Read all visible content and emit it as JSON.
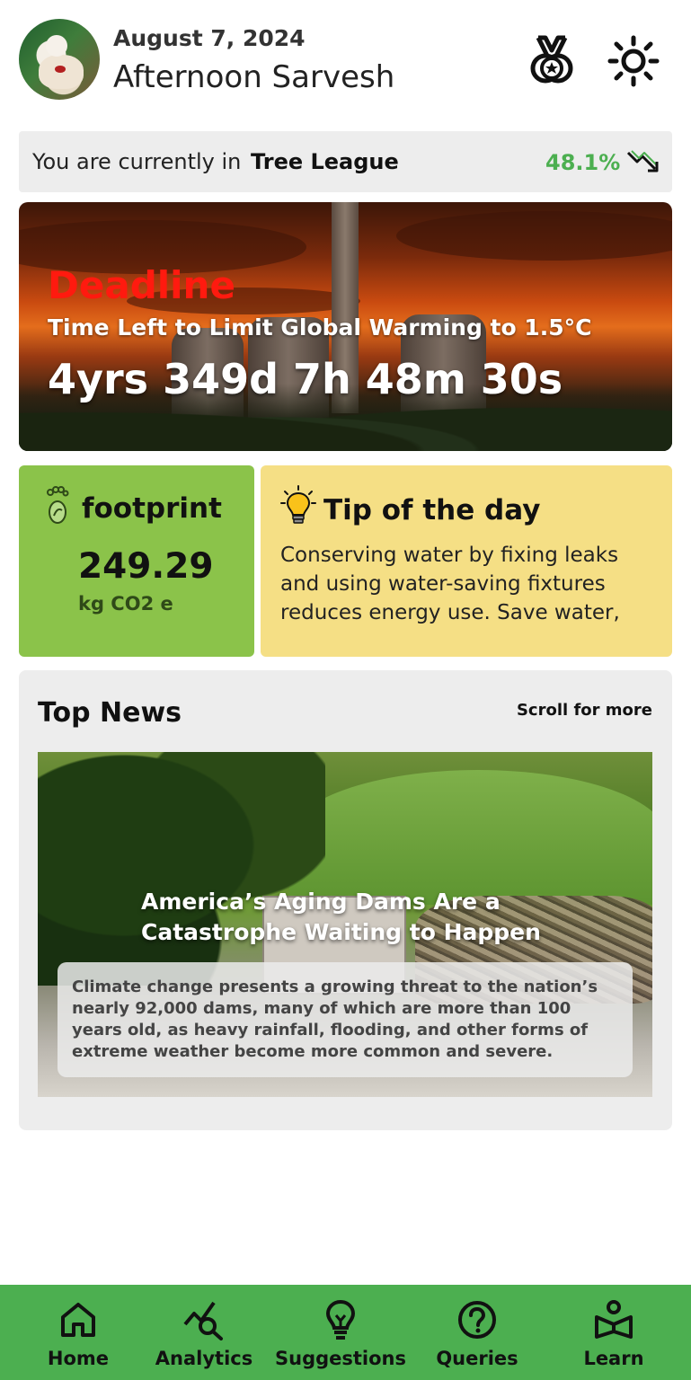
{
  "header": {
    "date": "August 7, 2024",
    "greeting": "Afternoon Sarvesh",
    "achievements_icon": "medal-icon",
    "theme_icon": "sun-icon"
  },
  "league": {
    "prefix": "You are currently in",
    "name": "Tree League",
    "percent": "48.1%",
    "trend_icon": "trending-down-icon",
    "trend_color": "#4caf50"
  },
  "deadline": {
    "title": "Deadline",
    "subtitle": "Time Left to Limit Global Warming to 1.5°C",
    "countdown": "4yrs 349d 7h 48m 30s",
    "title_color": "#ff1a0f"
  },
  "footprint": {
    "title": "footprint",
    "value": "249.29",
    "unit": "kg CO2 e",
    "icon": "footprint-icon",
    "color": "#8bc34a"
  },
  "tip": {
    "title": "Tip of the day",
    "text": "Conserving water by fixing leaks and using water-saving fixtures reduces energy use. Save water,",
    "icon": "lightbulb-icon",
    "color": "#f5df85"
  },
  "news": {
    "title": "Top News",
    "more_label": "Scroll for more",
    "items": [
      {
        "headline": "America’s Aging Dams Are a Catastrophe Waiting to Happen",
        "summary": "Climate change presents a growing threat to the nation’s nearly 92,000 dams, many of which are more than 100 years old, as heavy rainfall, flooding, and other forms of extreme weather become more common and severe."
      }
    ]
  },
  "nav": {
    "color": "#4caf50",
    "items": [
      {
        "label": "Home",
        "icon": "home-icon"
      },
      {
        "label": "Analytics",
        "icon": "analytics-icon"
      },
      {
        "label": "Suggestions",
        "icon": "lightbulb-icon"
      },
      {
        "label": "Queries",
        "icon": "question-icon"
      },
      {
        "label": "Learn",
        "icon": "learn-icon"
      }
    ]
  }
}
